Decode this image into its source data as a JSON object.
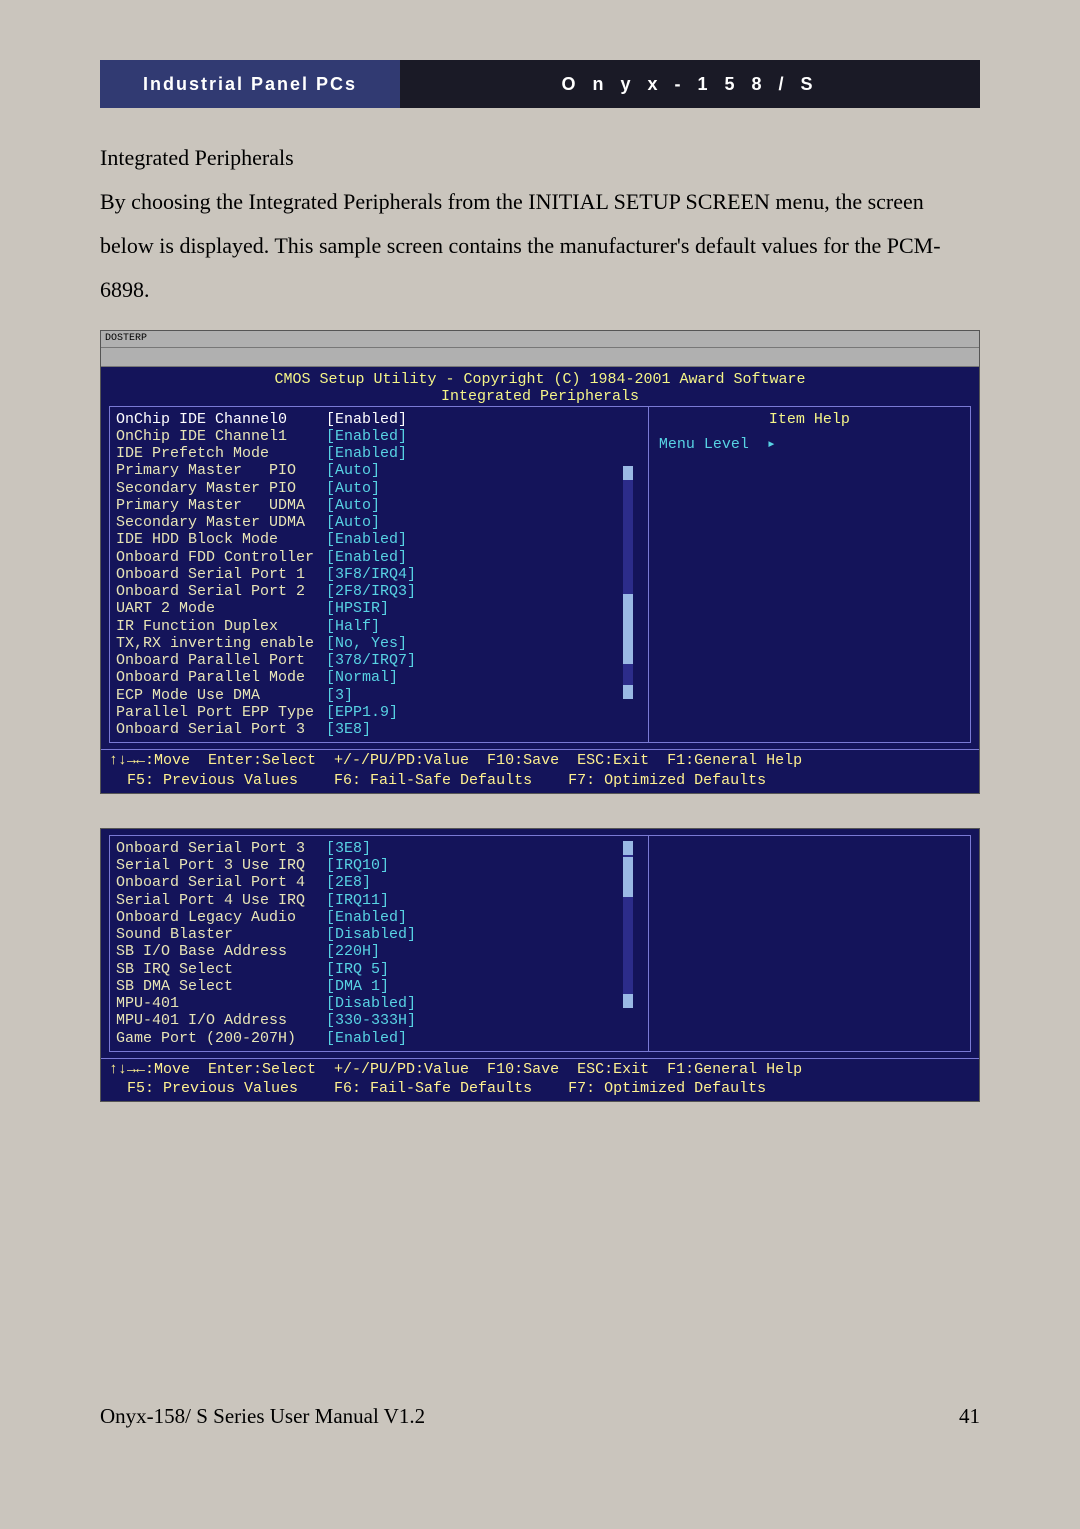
{
  "header": {
    "left": "Industrial Panel PCs",
    "right": "O n y x - 1 5 8 / S"
  },
  "section": {
    "heading": "Integrated Peripherals",
    "para": "By choosing the Integrated Peripherals from the INITIAL SETUP SCREEN menu, the screen below is displayed. This sample screen contains the manufacturer's default values for the PCM-6898."
  },
  "bios1": {
    "titlebarText": "DOSTERP",
    "title": "CMOS Setup Utility - Copyright (C) 1984-2001 Award Software",
    "subtitle": "Integrated Peripherals",
    "help": {
      "title": "Item Help",
      "menuLevel": "Menu Level",
      "arrow": "▸"
    },
    "rows": [
      {
        "label": "OnChip IDE Channel0",
        "value": "[Enabled]",
        "sel": true
      },
      {
        "label": "OnChip IDE Channel1",
        "value": "[Enabled]"
      },
      {
        "label": "IDE Prefetch Mode",
        "value": "[Enabled]"
      },
      {
        "label": "Primary Master   PIO",
        "value": "[Auto]"
      },
      {
        "label": "Secondary Master PIO",
        "value": "[Auto]"
      },
      {
        "label": "Primary Master   UDMA",
        "value": "[Auto]"
      },
      {
        "label": "Secondary Master UDMA",
        "value": "[Auto]"
      },
      {
        "label": "IDE HDD Block Mode",
        "value": "[Enabled]"
      },
      {
        "label": "Onboard FDD Controller",
        "value": "[Enabled]"
      },
      {
        "label": "Onboard Serial Port 1",
        "value": "[3F8/IRQ4]"
      },
      {
        "label": "Onboard Serial Port 2",
        "value": "[2F8/IRQ3]"
      },
      {
        "label": "UART 2 Mode",
        "value": "[HPSIR]"
      },
      {
        "label": "IR Function Duplex",
        "value": "[Half]"
      },
      {
        "label": "TX,RX inverting enable",
        "value": "[No, Yes]"
      },
      {
        "label": "Onboard Parallel Port",
        "value": "[378/IRQ7]"
      },
      {
        "label": "Onboard Parallel Mode",
        "value": "[Normal]"
      },
      {
        "label": "ECP Mode Use DMA",
        "value": "[3]"
      },
      {
        "label": "Parallel Port EPP Type",
        "value": "[EPP1.9]"
      },
      {
        "label": "Onboard Serial Port 3",
        "value": "[3E8]"
      }
    ],
    "footer1": "↑↓→←:Move  Enter:Select  +/-/PU/PD:Value  F10:Save  ESC:Exit  F1:General Help",
    "footer2": "  F5: Previous Values    F6: Fail-Safe Defaults    F7: Optimized Defaults"
  },
  "bios2": {
    "rows": [
      {
        "label": "Onboard Serial Port 3",
        "value": "[3E8]"
      },
      {
        "label": "Serial Port 3 Use IRQ",
        "value": "[IRQ10]"
      },
      {
        "label": "Onboard Serial Port 4",
        "value": "[2E8]"
      },
      {
        "label": "Serial Port 4 Use IRQ",
        "value": "[IRQ11]"
      },
      {
        "label": "Onboard Legacy Audio",
        "value": "[Enabled]"
      },
      {
        "label": "Sound Blaster",
        "value": "[Disabled]"
      },
      {
        "label": "SB I/O Base Address",
        "value": "[220H]"
      },
      {
        "label": "SB IRQ Select",
        "value": "[IRQ 5]"
      },
      {
        "label": "SB DMA Select",
        "value": "[DMA 1]"
      },
      {
        "label": "MPU-401",
        "value": "[Disabled]"
      },
      {
        "label": "MPU-401 I/O Address",
        "value": "[330-333H]"
      },
      {
        "label": "Game Port (200-207H)",
        "value": "[Enabled]"
      }
    ],
    "footer1": "↑↓→←:Move  Enter:Select  +/-/PU/PD:Value  F10:Save  ESC:Exit  F1:General Help",
    "footer2": "  F5: Previous Values    F6: Fail-Safe Defaults    F7: Optimized Defaults"
  },
  "footer": {
    "left": "Onyx-158/ S Series User Manual V1.2",
    "right": "41"
  }
}
